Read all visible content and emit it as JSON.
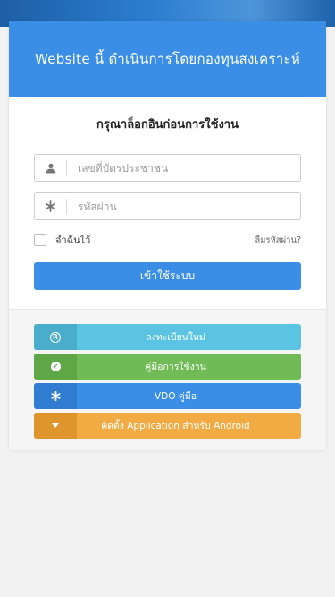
{
  "header": {
    "title": "Website นี้ ดำเนินการโดยกองทุนสงเคราะห์"
  },
  "login": {
    "title": "กรุณาล็อกอินก่อนการใช้งาน",
    "username_placeholder": "เลขที่บัตรประชาชน",
    "password_placeholder": "รหัสผ่าน",
    "remember_label": "จำฉันไว้",
    "forgot_label": "ลืมรหัสผ่าน?",
    "submit_label": "เข้าใช้ระบบ"
  },
  "actions": [
    {
      "label": "ลงทะเบียนใหม่",
      "icon": "registered-icon",
      "color": "#5bc4e2"
    },
    {
      "label": "คู่มือการใช้งาน",
      "icon": "check-circle-icon",
      "color": "#70bb55"
    },
    {
      "label": "VDO คู่มือ",
      "icon": "asterisk-icon",
      "color": "#3a8ee6"
    },
    {
      "label": "ติดตั้ง Application สำหรับ Android",
      "icon": "caret-down-icon",
      "color": "#f2aa42"
    }
  ],
  "colors": {
    "primary": "#3a8ee6",
    "info": "#5bc4e2",
    "success": "#70bb55",
    "warning": "#f2aa42"
  }
}
